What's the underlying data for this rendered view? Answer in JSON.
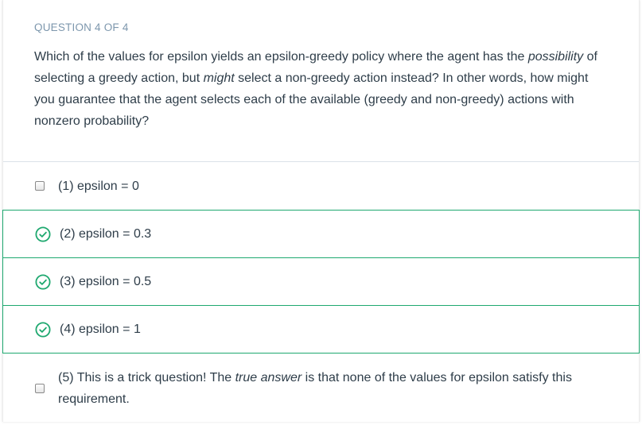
{
  "question": {
    "count": "QUESTION 4 OF 4",
    "text_part1": "Which of the values for epsilon yields an epsilon-greedy policy where the agent has the ",
    "text_em1": "possibility",
    "text_part2": " of selecting a greedy action, but ",
    "text_em2": "might",
    "text_part3": " select a non-greedy action instead? In other words, how might you guarantee that the agent selects each of the available (greedy and non-greedy) actions with nonzero probability?"
  },
  "options": [
    {
      "label": "(1) epsilon = 0",
      "state": "unchecked"
    },
    {
      "label": "(2) epsilon = 0.3",
      "state": "correct"
    },
    {
      "label": "(3) epsilon = 0.5",
      "state": "correct"
    },
    {
      "label": "(4) epsilon = 1",
      "state": "correct"
    },
    {
      "label_part1": "(5) This is a trick question! The ",
      "label_em": "true answer",
      "label_part2": " is that none of the values for epsilon satisfy this requirement.",
      "state": "unchecked"
    }
  ],
  "icons": {
    "correct": "check-circle-icon",
    "unchecked": "checkbox-icon"
  },
  "colors": {
    "correct_accent": "#1ea86f",
    "question_count": "#7d97ad",
    "text": "#2e3d49"
  }
}
